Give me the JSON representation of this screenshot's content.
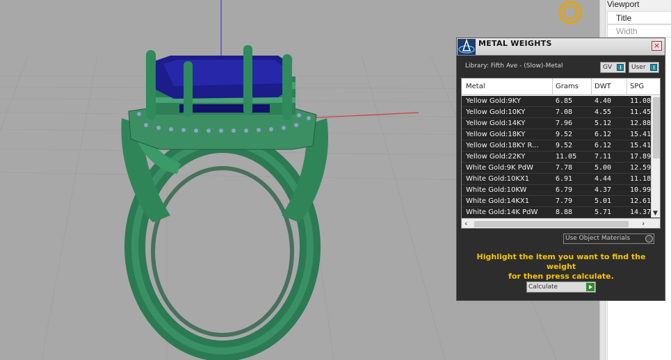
{
  "properties_panel": {
    "header": "Viewport",
    "rows": [
      "Title",
      "Width"
    ]
  },
  "dialog": {
    "title": "METAL WEIGHTS",
    "close": "×",
    "library": "Library: Fifth Ave - (Slow)-Metal",
    "toggle_gv": "GV",
    "toggle_user": "User",
    "columns": [
      "Metal",
      "Grams",
      "DWT",
      "SPG"
    ],
    "rows": [
      [
        "Yellow Gold:9KY",
        "6.85",
        "4.40",
        "11.08"
      ],
      [
        "Yellow Gold:10KY",
        "7.08",
        "4.55",
        "11.45"
      ],
      [
        "Yellow Gold:14KY",
        "7.96",
        "5.12",
        "12.88"
      ],
      [
        "Yellow Gold:18KY",
        "9.52",
        "6.12",
        "15.41"
      ],
      [
        "Yellow Gold:18KY R...",
        "9.52",
        "6.12",
        "15.41"
      ],
      [
        "Yellow Gold:22KY",
        "11.05",
        "7.11",
        "17.89"
      ],
      [
        "White Gold:9K PdW",
        "7.78",
        "5.00",
        "12.59"
      ],
      [
        "White Gold:10KX1",
        "6.91",
        "4.44",
        "11.18"
      ],
      [
        "White Gold:10KW",
        "6.79",
        "4.37",
        "10.99"
      ],
      [
        "White Gold:14KX1",
        "7.79",
        "5.01",
        "12.61"
      ],
      [
        "White Gold:14K PdW",
        "8.88",
        "5.71",
        "14.37"
      ]
    ],
    "use_object_materials": "Use Object Materials",
    "hint_line1": "Highlight the item you want to find the weight",
    "hint_line2": "for then press calculate.",
    "calculate": "Calculate",
    "colors": {
      "hint": "#f5c600",
      "row_bg": "#262626",
      "dialog_bg": "#2d2d2d"
    }
  }
}
